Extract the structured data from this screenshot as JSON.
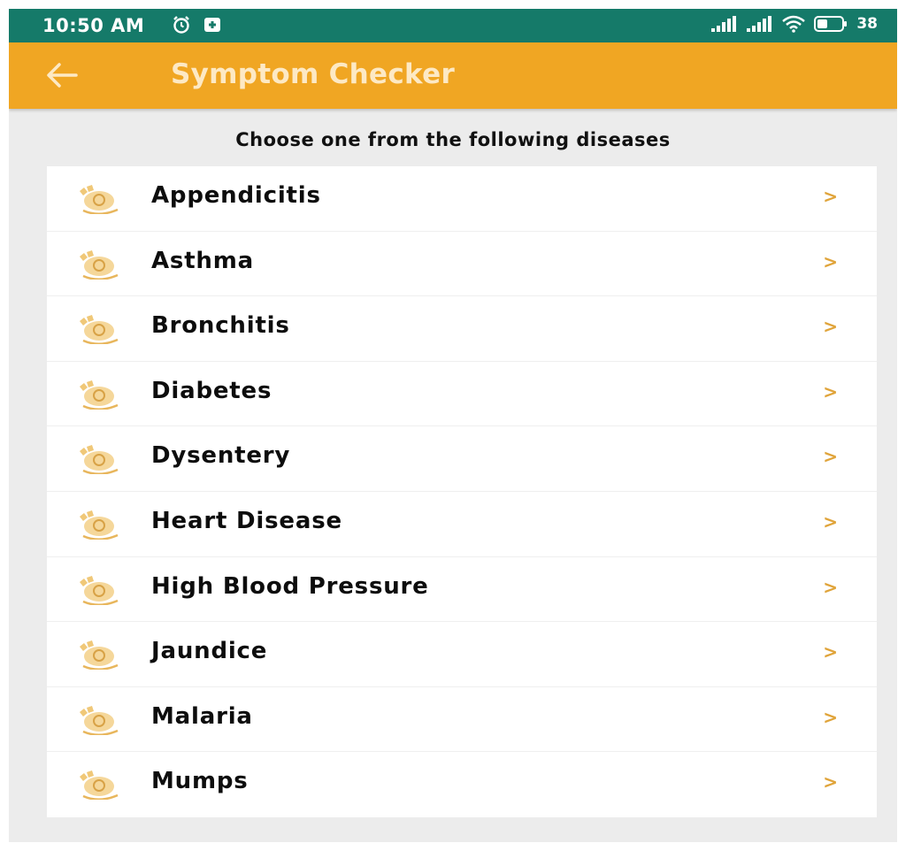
{
  "status_bar": {
    "time": "10:50 AM",
    "battery_percent": "38"
  },
  "app_bar": {
    "title": "Symptom Checker",
    "back_icon": "arrow-left-icon"
  },
  "content": {
    "instruction": "Choose one from the following diseases",
    "diseases": [
      "Appendicitis",
      "Asthma",
      "Bronchitis",
      "Diabetes",
      "Dysentery",
      "Heart Disease",
      "High Blood Pressure",
      "Jaundice",
      "Malaria",
      "Mumps"
    ],
    "chevron": ">",
    "item_icon": "medical-badge-icon"
  },
  "colors": {
    "status_bar": "#157a69",
    "app_bar": "#f0a623",
    "title_text": "#fde9c4",
    "chevron": "#e0a43a",
    "background": "#ececec"
  }
}
